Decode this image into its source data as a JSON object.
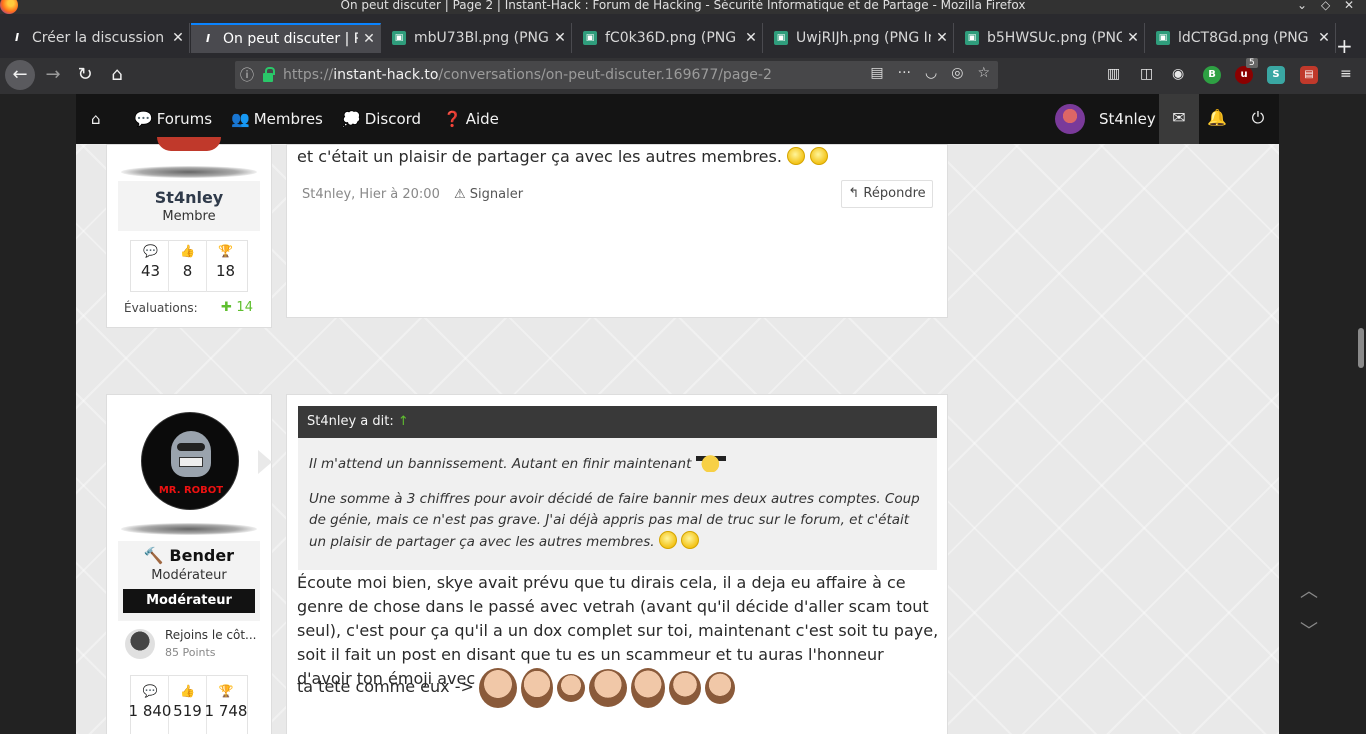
{
  "window": {
    "title": "On peut discuter | Page 2 | Instant-Hack : Forum de Hacking - Sécurité Informatique et de Partage - Mozilla Firefox"
  },
  "tabs": [
    {
      "label": "Créer la discussion | I",
      "fav": "ih"
    },
    {
      "label": "On peut discuter | Pa",
      "fav": "ih"
    },
    {
      "label": "mbU73Bl.png (PNG I",
      "fav": "img"
    },
    {
      "label": "fC0k36D.png (PNG Im",
      "fav": "img"
    },
    {
      "label": "UwjRIJh.png (PNG Im",
      "fav": "img"
    },
    {
      "label": "b5HWSUc.png (PNG",
      "fav": "img"
    },
    {
      "label": "ldCT8Gd.png (PNG Im",
      "fav": "img"
    }
  ],
  "urlbar": {
    "scheme": "https://",
    "host": "instant-hack.to",
    "path": "/conversations/on-peut-discuter.169677/page-2"
  },
  "extensions": {
    "badge_count": "5"
  },
  "forum_nav": {
    "forums": "Forums",
    "members": "Membres",
    "discord": "Discord",
    "help": "Aide",
    "username": "St4nley"
  },
  "post1": {
    "author": "St4nley",
    "role": "Membre",
    "stats": {
      "messages": "43",
      "likes": "8",
      "trophies": "18"
    },
    "ratings_label": "Évaluations:",
    "ratings_value": "14",
    "text_end": "et c'était un plaisir de partager ça avec les autres membres.",
    "meta": "St4nley, Hier à 20:00",
    "report": "Signaler",
    "reply": "Répondre"
  },
  "post2": {
    "author": "Bender",
    "role": "Modérateur",
    "badge": "Modérateur",
    "avatar_text": "MR. ROBOT",
    "trophy_title": "Rejoins le côt...",
    "trophy_points": "85 Points",
    "stats": {
      "messages": "1 840",
      "likes": "519",
      "trophies": "1 748"
    },
    "quote": {
      "header": "St4nley a dit:",
      "arrow": "↑",
      "line1": "Il m'attend un bannissement. Autant en finir maintenant",
      "line2": "Une somme à 3 chiffres pour avoir décidé de faire bannir mes deux autres comptes. Coup de génie, mais ce n'est pas grave. J'ai déjà appris pas mal de truc sur le forum, et c'était un plaisir de partager ça avec les autres membres."
    },
    "body": "Écoute moi bien, skye avait prévu que tu dirais cela, il a deja eu affaire à ce genre de chose dans le passé avec vetrah (avant qu'il décide d'aller scam tout seul), c'est pour ça qu'il a un dox complet sur toi, maintenant c'est soit tu paye, soit il fait un post en disant que tu es un scammeur et tu auras l'honneur d'avoir ton émoji avec",
    "body_end": "ta tete comme eux ->"
  },
  "colors": {
    "accent": "#0a84ff",
    "positive": "#5fbf2f",
    "nav_bg": "#141414"
  }
}
